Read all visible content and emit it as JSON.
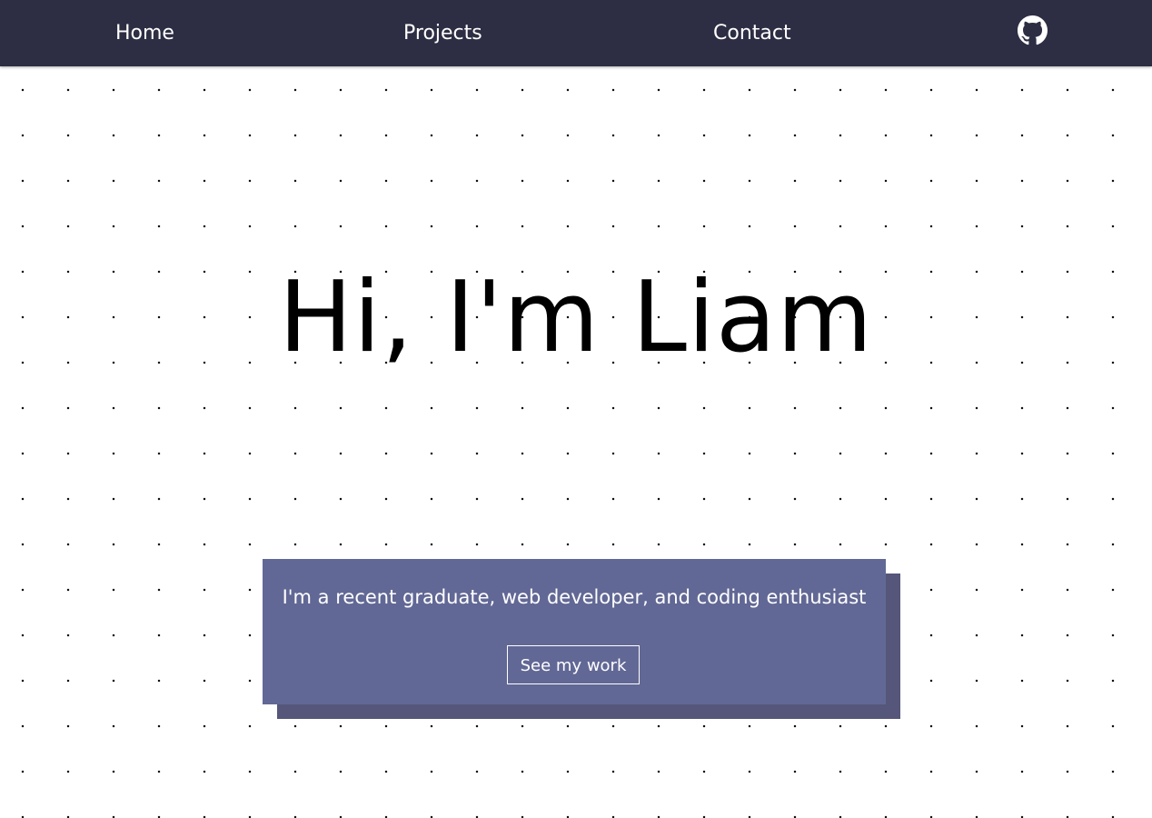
{
  "nav": {
    "links": [
      {
        "label": "Home"
      },
      {
        "label": "Projects"
      },
      {
        "label": "Contact"
      }
    ],
    "github_icon": "github-icon",
    "background_color": "#2d2e43"
  },
  "hero": {
    "title": "Hi, I'm Liam"
  },
  "card": {
    "text": "I'm a recent graduate, web developer, and coding enthusiast",
    "button_label": "See my work",
    "background_color": "#626895",
    "shadow_color": "#55567a"
  }
}
